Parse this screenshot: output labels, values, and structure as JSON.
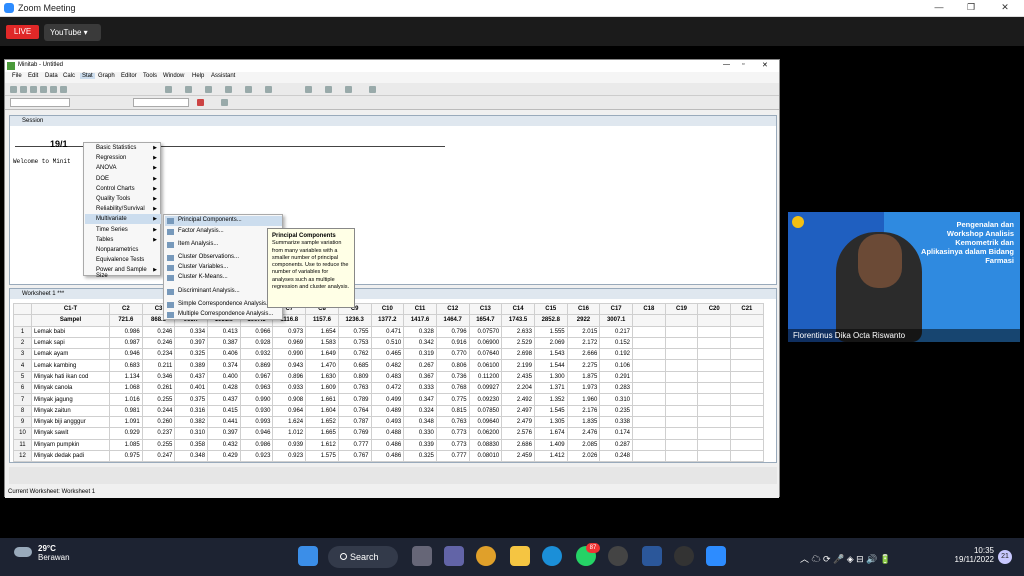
{
  "zoom": {
    "title": "Zoom Meeting",
    "live": "LIVE",
    "youtube": "YouTube ▾"
  },
  "minitab": {
    "title": "Minitab - Untitled",
    "menu": [
      "File",
      "Edit",
      "Data",
      "Calc",
      "Stat",
      "Graph",
      "Editor",
      "Tools",
      "Window",
      "Help",
      "Assistant"
    ],
    "session_title": "Session",
    "session_date": "19/1",
    "session_welcome": "Welcome to Minit",
    "worksheet_title": "Worksheet 1 ***",
    "status": "Current Worksheet: Worksheet 1"
  },
  "stat_menu": [
    "Basic Statistics",
    "Regression",
    "ANOVA",
    "DOE",
    "Control Charts",
    "Quality Tools",
    "Reliability/Survival",
    "Multivariate",
    "Time Series",
    "Tables",
    "Nonparametrics",
    "Equivalence Tests",
    "Power and Sample Size"
  ],
  "mv_menu": [
    "Principal Components...",
    "Factor Analysis...",
    "Item Analysis...",
    "Cluster Observations...",
    "Cluster Variables...",
    "Cluster K-Means...",
    "Discriminant Analysis...",
    "Simple Correspondence Analysis...",
    "Multiple Correspondence Analysis..."
  ],
  "tooltip": {
    "title": "Principal Components",
    "body": "Summarize sample variation from many variables with a smaller number of principal components. Use to reduce the number of variables for analyses such as multiple regression and cluster analysis."
  },
  "table": {
    "cols": [
      "C1-T",
      "C2",
      "C3",
      "C4",
      "C5",
      "C6",
      "C7",
      "C8",
      "C9",
      "C10",
      "C11",
      "C12",
      "C13",
      "C14",
      "C15",
      "C16",
      "C17",
      "C18",
      "C19",
      "C20",
      "C21"
    ],
    "sub": [
      "Sampel",
      "721.6",
      "868.3",
      "965.7",
      "1031.9",
      "1097.3",
      "1116.8",
      "1157.6",
      "1236.3",
      "1377.2",
      "1417.6",
      "1464.7",
      "1654.7",
      "1743.5",
      "2852.8",
      "2922",
      "3007.1",
      "",
      "",
      "",
      ""
    ],
    "rows": [
      [
        "1",
        "Lemak babi",
        "0.986",
        "0.246",
        "0.334",
        "0.413",
        "0.966",
        "0.973",
        "1.654",
        "0.755",
        "0.471",
        "0.328",
        "0.796",
        "0.07570",
        "2.633",
        "1.555",
        "2.015",
        "0.217"
      ],
      [
        "2",
        "Lemak sapi",
        "0.987",
        "0.246",
        "0.397",
        "0.387",
        "0.928",
        "0.969",
        "1.583",
        "0.753",
        "0.510",
        "0.342",
        "0.916",
        "0.06900",
        "2.529",
        "2.069",
        "2.172",
        "0.152"
      ],
      [
        "3",
        "Lemak ayam",
        "0.946",
        "0.234",
        "0.325",
        "0.406",
        "0.932",
        "0.990",
        "1.649",
        "0.762",
        "0.465",
        "0.319",
        "0.770",
        "0.07640",
        "2.698",
        "1.543",
        "2.666",
        "0.192"
      ],
      [
        "4",
        "Lemak kambing",
        "0.683",
        "0.211",
        "0.389",
        "0.374",
        "0.869",
        "0.943",
        "1.470",
        "0.685",
        "0.482",
        "0.267",
        "0.806",
        "0.06100",
        "2.199",
        "1.544",
        "2.275",
        "0.106"
      ],
      [
        "5",
        "Minyak hati ikan cod",
        "1.134",
        "0.346",
        "0.437",
        "0.400",
        "0.967",
        "0.896",
        "1.630",
        "0.809",
        "0.483",
        "0.367",
        "0.736",
        "0.11200",
        "2.435",
        "1.300",
        "1.875",
        "0.291"
      ],
      [
        "6",
        "Minyak canola",
        "1.068",
        "0.261",
        "0.401",
        "0.428",
        "0.963",
        "0.933",
        "1.609",
        "0.763",
        "0.472",
        "0.333",
        "0.768",
        "0.09927",
        "2.204",
        "1.371",
        "1.973",
        "0.283"
      ],
      [
        "7",
        "Minyak jagung",
        "1.016",
        "0.255",
        "0.375",
        "0.437",
        "0.990",
        "0.908",
        "1.661",
        "0.789",
        "0.499",
        "0.347",
        "0.775",
        "0.09230",
        "2.492",
        "1.352",
        "1.960",
        "0.310"
      ],
      [
        "8",
        "Minyak zaitun",
        "0.981",
        "0.244",
        "0.316",
        "0.415",
        "0.930",
        "0.964",
        "1.604",
        "0.764",
        "0.489",
        "0.324",
        "0.815",
        "0.07850",
        "2.497",
        "1.545",
        "2.176",
        "0.235"
      ],
      [
        "9",
        "Minyak biji angggur",
        "1.091",
        "0.260",
        "0.382",
        "0.441",
        "0.993",
        "1.624",
        "1.652",
        "0.787",
        "0.493",
        "0.348",
        "0.763",
        "0.09640",
        "2.479",
        "1.305",
        "1.835",
        "0.338"
      ],
      [
        "10",
        "Minyak sawit",
        "0.929",
        "0.237",
        "0.310",
        "0.397",
        "0.946",
        "1.012",
        "1.665",
        "0.769",
        "0.488",
        "0.330",
        "0.773",
        "0.06200",
        "2.576",
        "1.674",
        "2.476",
        "0.174"
      ],
      [
        "11",
        "Minyam pumpkin",
        "1.085",
        "0.255",
        "0.358",
        "0.432",
        "0.986",
        "0.939",
        "1.612",
        "0.777",
        "0.486",
        "0.339",
        "0.773",
        "0.08830",
        "2.686",
        "1.409",
        "2.085",
        "0.287"
      ],
      [
        "12",
        "Minyak dedak padi",
        "0.975",
        "0.247",
        "0.348",
        "0.429",
        "0.923",
        "0.923",
        "1.575",
        "0.767",
        "0.486",
        "0.325",
        "0.777",
        "0.08010",
        "2.459",
        "1.412",
        "2.026",
        "0.248"
      ]
    ]
  },
  "video": {
    "slide_text": "Pengenalan dan Workshop Analisis Kemometrik dan Aplikasinya dalam Bidang Farmasi",
    "name": "Florentinus Dika Octa Riswanto"
  },
  "taskbar": {
    "temp": "29°C",
    "weather": "Berawan",
    "search": "Search",
    "time": "10:35",
    "date": "19/11/2022",
    "badge": "21",
    "wa_badge": "87"
  },
  "colors": {
    "accent": "#2d8cff",
    "live": "#e02828",
    "highlight": "#cde"
  }
}
